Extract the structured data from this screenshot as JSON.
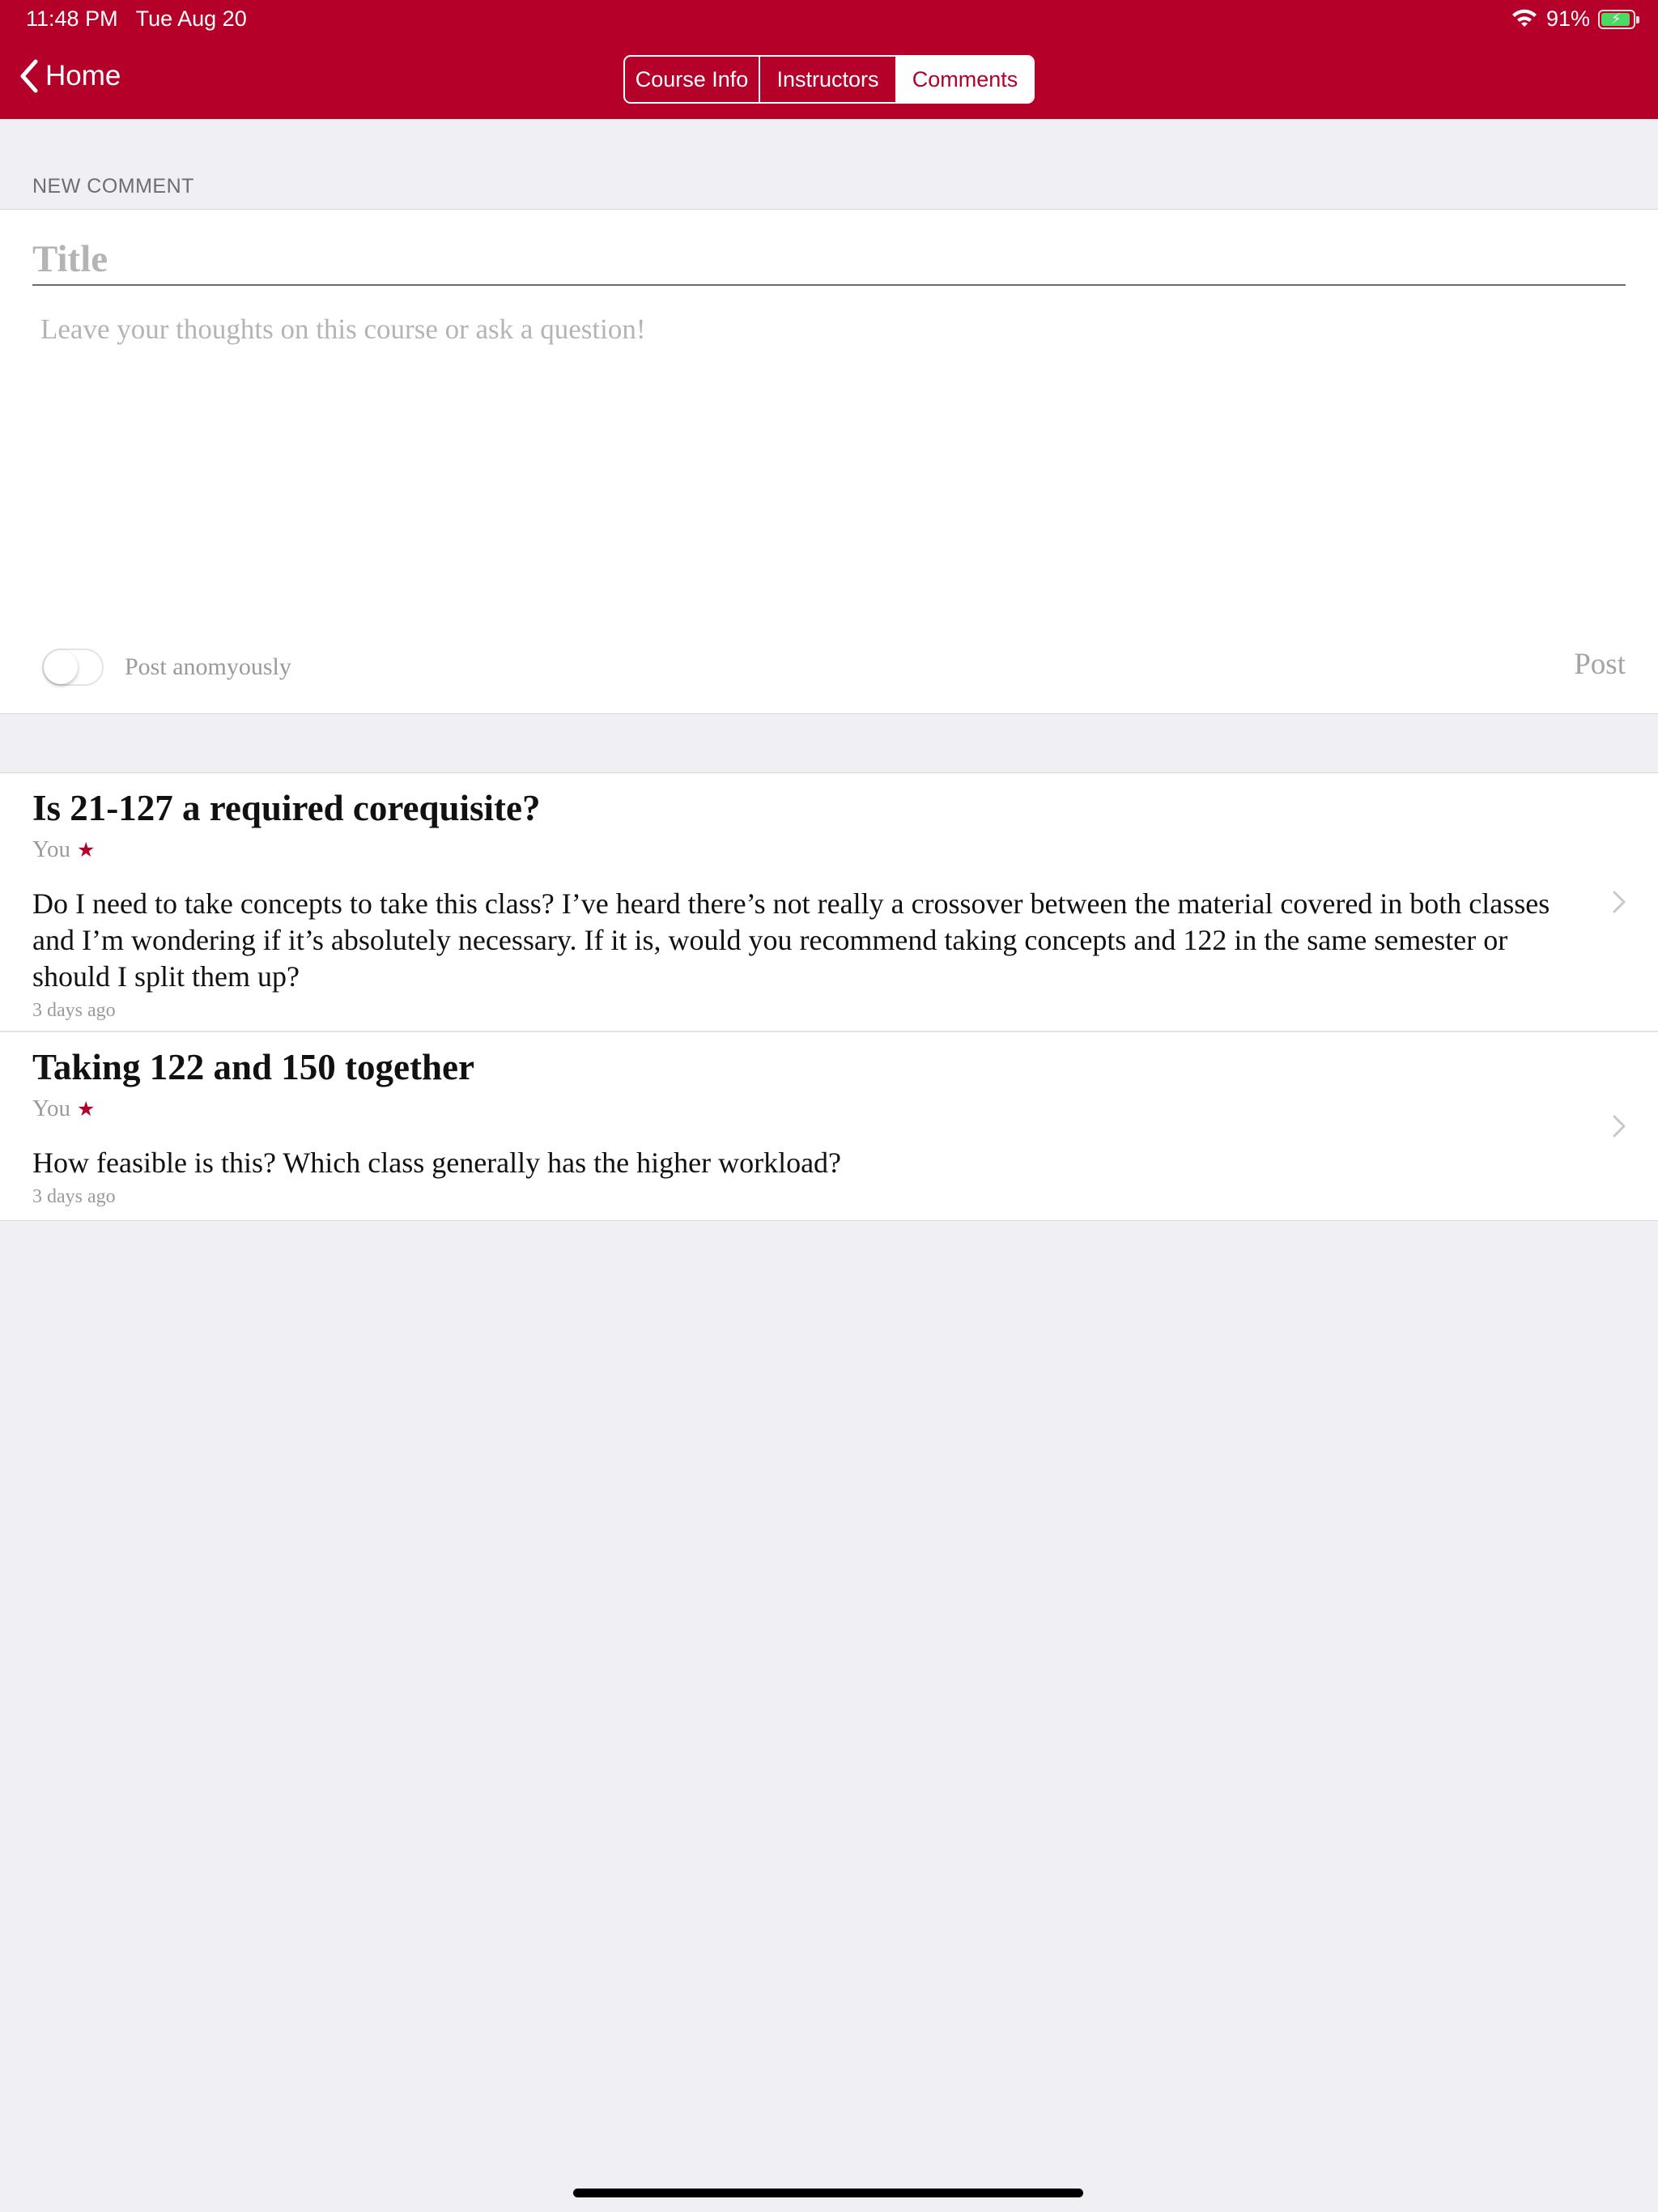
{
  "status_bar": {
    "time": "11:48 PM",
    "date": "Tue Aug 20",
    "battery": "91%",
    "battery_level": 0.91
  },
  "nav": {
    "back_label": "Home",
    "tabs": [
      {
        "label": "Course Info",
        "active": false
      },
      {
        "label": "Instructors",
        "active": false
      },
      {
        "label": "Comments",
        "active": true
      }
    ]
  },
  "new_comment": {
    "section_label": "NEW COMMENT",
    "title_placeholder": "Title",
    "body_placeholder": "Leave your thoughts on this course or ask a question!",
    "anonymous_label": "Post anomyously",
    "anonymous_on": false,
    "post_label": "Post"
  },
  "comments": [
    {
      "title": "Is 21-127 a required corequisite?",
      "author": "You",
      "star": "★",
      "body": "Do I need to take concepts to take this class?  I’ve heard there’s not really a crossover between the material covered in both classes and I’m wondering if it’s absolutely necessary.  If it is, would you recommend taking concepts and 122 in the same semester or should I split them up?",
      "time": "3 days ago"
    },
    {
      "title": "Taking 122 and 150 together",
      "author": "You",
      "star": "★",
      "body": "How feasible is this?  Which class generally has the higher workload?",
      "time": "3 days ago"
    }
  ],
  "colors": {
    "brand": "#b5002a",
    "background": "#efeff4",
    "placeholder": "#b4b4b4"
  }
}
